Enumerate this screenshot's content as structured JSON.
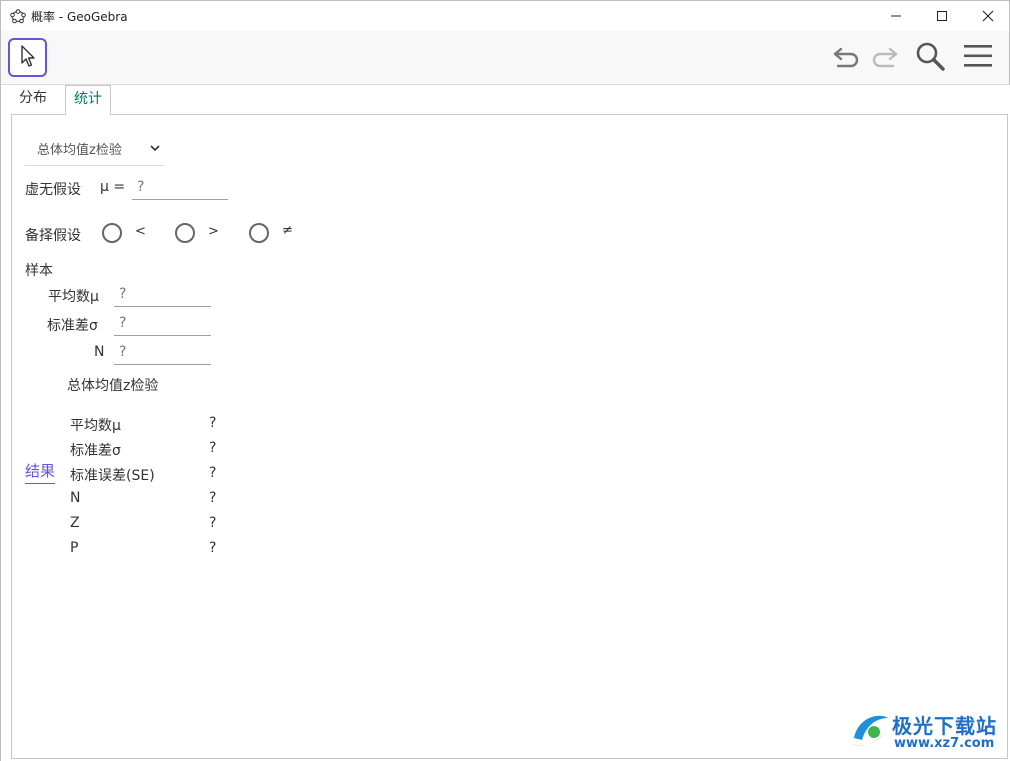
{
  "window": {
    "title": "概率 - GeoGebra",
    "app_icon": "geogebra-icon",
    "controls": [
      "minimize-icon",
      "maximize-icon",
      "close-icon"
    ]
  },
  "toolbar": {
    "active_tool": "move-tool-icon",
    "right_icons": [
      "undo-icon",
      "redo-icon",
      "search-icon",
      "menu-icon"
    ]
  },
  "tabs": [
    {
      "label": "分布",
      "active": false
    },
    {
      "label": "统计",
      "active": true
    }
  ],
  "test_select": {
    "value": "总体均值z检验",
    "icon": "chevron-down-icon"
  },
  "null_hypothesis": {
    "label": "虚无假设",
    "symbol": "μ =",
    "value": "?"
  },
  "alt_hypothesis": {
    "label": "备择假设",
    "options": [
      "<",
      ">",
      "≠"
    ]
  },
  "sample": {
    "heading": "样本",
    "fields": [
      {
        "label": "平均数μ",
        "value": "?"
      },
      {
        "label": "标准差σ",
        "value": "?"
      },
      {
        "label": "N",
        "value": "?"
      }
    ]
  },
  "results": {
    "title": "总体均值z检验",
    "label": "结果",
    "rows": [
      {
        "name": "平均数μ",
        "value": "?"
      },
      {
        "name": "标准差σ",
        "value": "?"
      },
      {
        "name": "标准误差(SE)",
        "value": "?"
      },
      {
        "name": "N",
        "value": "?"
      },
      {
        "name": "Z",
        "value": "?"
      },
      {
        "name": "P",
        "value": "?"
      }
    ]
  },
  "watermark": {
    "text": "极光下载站",
    "url": "www.xz7.com"
  },
  "colors": {
    "accent": "#6557d2",
    "tab_active": "#00796b",
    "watermark": "#1e6fc9"
  }
}
